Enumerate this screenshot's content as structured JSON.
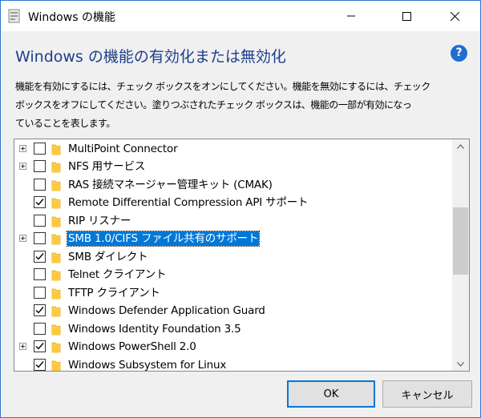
{
  "window": {
    "title": "Windows の機能",
    "controls": {
      "minimize_icon": "minimize-icon",
      "maximize_icon": "maximize-icon",
      "close_icon": "close-icon"
    }
  },
  "header": {
    "title": "Windows の機能の有効化または無効化",
    "help_label": "?"
  },
  "description": {
    "lines": [
      "機能を有効にするには、チェック ボックスをオンにしてください。機能を無効にするには、チェック",
      "ボックスをオフにしてください。塗りつぶされたチェック ボックスは、機能の一部が有効になっ",
      "ていることを表します。"
    ]
  },
  "features": [
    {
      "label": "MultiPoint Connector",
      "expandable": true,
      "checked": false,
      "selected": false
    },
    {
      "label": "NFS 用サービス",
      "expandable": true,
      "checked": false,
      "selected": false
    },
    {
      "label": "RAS 接続マネージャー管理キット (CMAK)",
      "expandable": false,
      "checked": false,
      "selected": false
    },
    {
      "label": "Remote Differential Compression API サポート",
      "expandable": false,
      "checked": true,
      "selected": false
    },
    {
      "label": "RIP リスナー",
      "expandable": false,
      "checked": false,
      "selected": false
    },
    {
      "label": "SMB 1.0/CIFS ファイル共有のサポート",
      "expandable": true,
      "checked": false,
      "selected": true
    },
    {
      "label": "SMB ダイレクト",
      "expandable": false,
      "checked": true,
      "selected": false
    },
    {
      "label": "Telnet クライアント",
      "expandable": false,
      "checked": false,
      "selected": false
    },
    {
      "label": "TFTP クライアント",
      "expandable": false,
      "checked": false,
      "selected": false
    },
    {
      "label": "Windows Defender Application Guard",
      "expandable": false,
      "checked": true,
      "selected": false
    },
    {
      "label": "Windows Identity Foundation 3.5",
      "expandable": false,
      "checked": false,
      "selected": false
    },
    {
      "label": "Windows PowerShell 2.0",
      "expandable": true,
      "checked": true,
      "selected": false
    },
    {
      "label": "Windows Subsystem for Linux",
      "expandable": false,
      "checked": true,
      "selected": false
    }
  ],
  "buttons": {
    "ok_label": "OK",
    "cancel_label": "キャンセル"
  },
  "colors": {
    "heading": "#1d3f8c",
    "selection": "#0078d7",
    "window_border": "#2b78d0"
  }
}
